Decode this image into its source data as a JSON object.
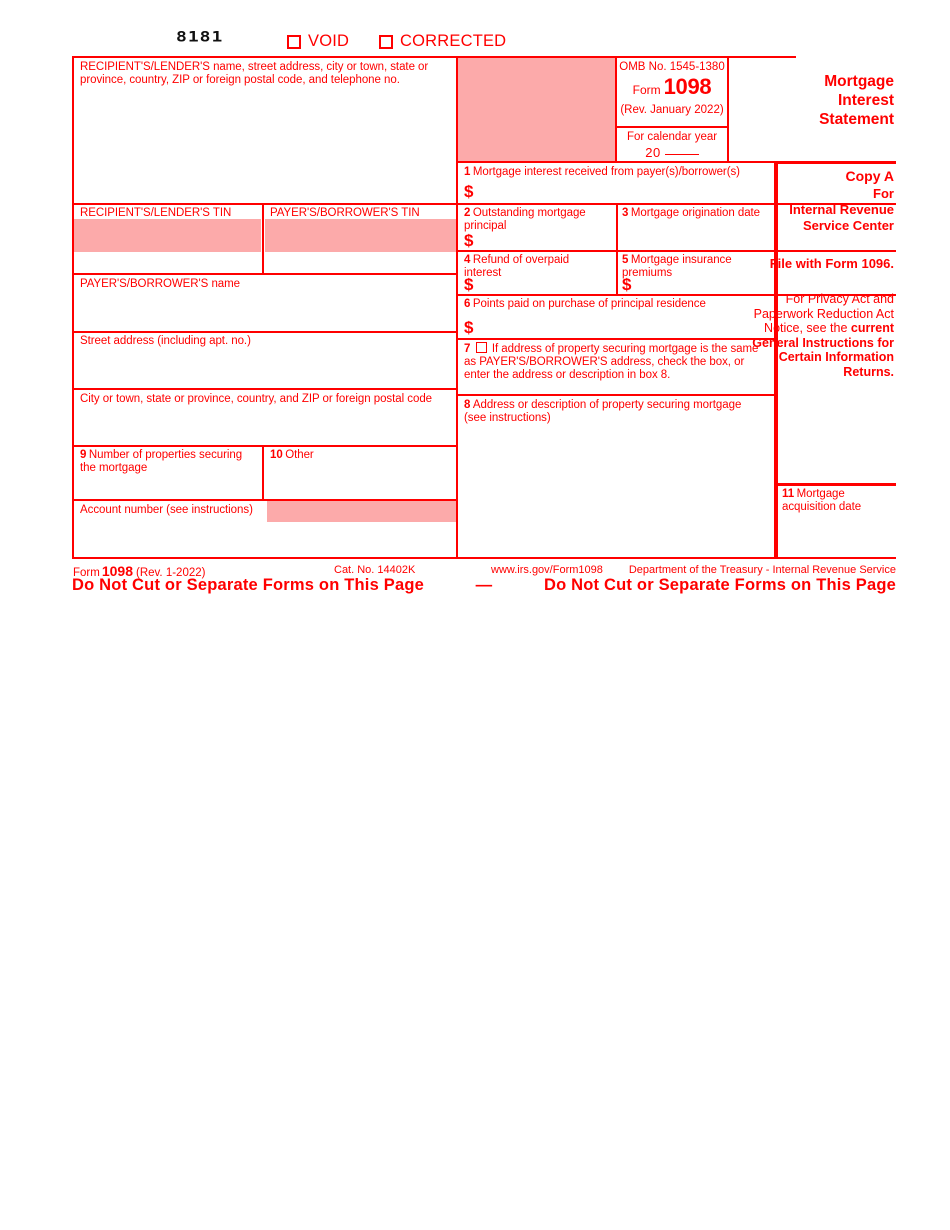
{
  "meta": {
    "colors": {
      "red": "#ff0000",
      "pink_fill": "#fcaaaa",
      "ocr_black": "#111111"
    }
  },
  "top": {
    "ocr_code": "8181",
    "void_label": "VOID",
    "corrected_label": "CORRECTED"
  },
  "left_column": {
    "recipient_name_label": "RECIPIENT'S/LENDER'S name, street address, city or town, state or province, country, ZIP or foreign postal code, and telephone no.",
    "recipient_tin_label": "RECIPIENT'S/LENDER'S TIN",
    "payer_tin_label": "PAYER'S/BORROWER'S TIN",
    "payer_name_label": "PAYER'S/BORROWER'S name",
    "street_address_label": "Street address (including apt. no.)",
    "city_label": "City or town, state or province, country, and ZIP or foreign postal code",
    "account_number_label": "Account number (see instructions)"
  },
  "omb": {
    "omb_no": "OMB No. 1545-1380",
    "form_word": "Form",
    "form_number": "1098",
    "revision": "(Rev. January 2022)",
    "calendar_year_label": "For calendar year",
    "year_prefix": "20"
  },
  "title": {
    "line1": "Mortgage",
    "line2": "Interest",
    "line3": "Statement"
  },
  "copy": {
    "copy_a": "Copy A",
    "for_word": "For",
    "irs_line1": "Internal Revenue",
    "irs_line2": "Service Center",
    "file_with": "File with Form 1096.",
    "privacy_regular": "For Privacy Act and Paperwork Reduction Act Notice, see the",
    "privacy_bold": "current General Instructions for Certain Information Returns."
  },
  "boxes": [
    {
      "num": "1",
      "label": "Mortgage interest received from payer(s)/borrower(s)",
      "dollar": "$"
    },
    {
      "num": "2",
      "label": "Outstanding mortgage principal",
      "dollar": "$"
    },
    {
      "num": "3",
      "label": "Mortgage origination date",
      "dollar": ""
    },
    {
      "num": "4",
      "label": "Refund of overpaid interest",
      "dollar": "$"
    },
    {
      "num": "5",
      "label": "Mortgage insurance premiums",
      "dollar": "$"
    },
    {
      "num": "6",
      "label": "Points paid on purchase of principal residence",
      "dollar": "$"
    },
    {
      "num": "7",
      "label": "If address of property securing mortgage is the same as PAYER'S/BORROWER'S address, check the box, or enter the address or description in box 8.",
      "dollar": ""
    },
    {
      "num": "8",
      "label": "Address or description of property securing mortgage (see instructions)",
      "dollar": ""
    },
    {
      "num": "9",
      "label": "Number of properties securing the mortgage",
      "dollar": ""
    },
    {
      "num": "10",
      "label": "Other",
      "dollar": ""
    },
    {
      "num": "11",
      "label": "Mortgage acquisition date",
      "dollar": ""
    }
  ],
  "footer": {
    "form_word": "Form",
    "form_number": "1098",
    "revision": "(Rev. 1-2022)",
    "cat_no": "Cat. No. 14402K",
    "url": "www.irs.gov/Form1098",
    "department": "Department of the Treasury - Internal Revenue Service",
    "donotcut_left": "Do  Not  Cut  or  Separate  Forms  on  This  Page",
    "donotcut_dash": "—",
    "donotcut_right": "Do  Not  Cut  or  Separate  Forms  on  This  Page"
  }
}
